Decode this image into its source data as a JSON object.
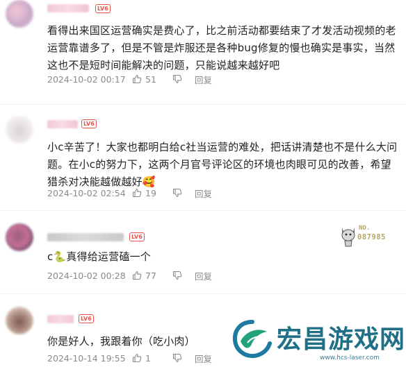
{
  "comments": [
    {
      "level": "LV6",
      "text": "看得出来国区运营确实是费心了，比之前活动都要结束了才发活动视频的老运营靠谱多了，但是不管是炸服还是各种bug修复的慢也确实是事实，当然这也不是短时间能解决的问题，只能说越来越好吧",
      "date": "2024-10-02 00:17",
      "likes": "51",
      "reply": "回复"
    },
    {
      "level": "LV6",
      "text": "小c辛苦了！大家也都明白给c社当运营的难处，把话讲清楚也不是什么大问题。在小c的努力下，这两个月官号评论区的环境也肉眼可见的改善，希望猎杀对决能越做越好🥰",
      "date": "2024-10-02 02:54",
      "likes": "19",
      "reply": "回复"
    },
    {
      "level": "LV6",
      "text": "c🐍真得给运营磕一个",
      "date": "2024-10-02 00:28",
      "likes": "77",
      "reply": "回复",
      "badge": {
        "no": "NO.",
        "number": "087985"
      }
    },
    {
      "level": "LV6",
      "text": "你是好人，我跟着你（吃小肉）",
      "date": "2024-10-14 19:55",
      "likes": "1",
      "reply": "回复"
    }
  ],
  "watermark": {
    "title": "宏昌游戏网",
    "url": "www.hcs-laser.com"
  },
  "colors": {
    "level_badge": "#e8534c",
    "meta_gray": "#8a8a8a",
    "watermark": "#1f6f86"
  },
  "icons": [
    "thumbs-up-icon",
    "thumbs-down-icon",
    "avatar-image",
    "watermark-logo"
  ]
}
